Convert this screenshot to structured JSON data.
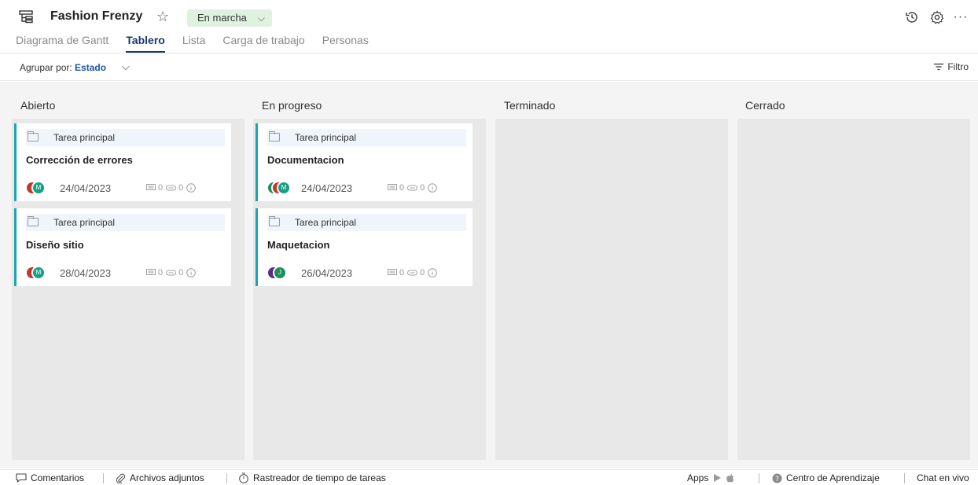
{
  "header": {
    "project_title": "Fashion Frenzy",
    "status": "En marcha",
    "icons": [
      "project-icon",
      "star-icon",
      "history-icon",
      "settings-icon",
      "more-icon"
    ],
    "tabs": [
      {
        "label": "Diagrama de Gantt",
        "active": false
      },
      {
        "label": "Tablero",
        "active": true
      },
      {
        "label": "Lista",
        "active": false
      },
      {
        "label": "Carga de trabajo",
        "active": false
      },
      {
        "label": "Personas",
        "active": false
      }
    ]
  },
  "toolbar": {
    "group_label": "Agrupar por:",
    "group_value": "Estado",
    "filter_label": "Filtro"
  },
  "columns": [
    {
      "title": "Abierto",
      "cards": [
        {
          "parent": "Tarea principal",
          "title": "Corrección de errores",
          "date": "24/04/2023",
          "comments": "0",
          "attachments": "0",
          "avatars": [
            "",
            "M"
          ]
        },
        {
          "parent": "Tarea principal",
          "title": "Diseño sitio",
          "date": "28/04/2023",
          "comments": "0",
          "attachments": "0",
          "avatars": [
            "",
            "M"
          ]
        }
      ]
    },
    {
      "title": "En progreso",
      "cards": [
        {
          "parent": "Tarea principal",
          "title": "Documentacion",
          "date": "24/04/2023",
          "comments": "0",
          "attachments": "0",
          "avatars": [
            "",
            "",
            "M"
          ]
        },
        {
          "parent": "Tarea principal",
          "title": "Maquetacion",
          "date": "26/04/2023",
          "comments": "0",
          "attachments": "0",
          "avatars": [
            "",
            "J"
          ]
        }
      ]
    },
    {
      "title": "Terminado",
      "cards": []
    },
    {
      "title": "Cerrado",
      "cards": []
    }
  ],
  "footer": {
    "comments": "Comentarios",
    "attachments": "Archivos adjuntos",
    "time_tracker": "Rastreador de tiempo de tareas",
    "apps": "Apps",
    "learning_center": "Centro de Aprendizaje",
    "live_chat": "Chat en vivo"
  },
  "colors": {
    "accent_navy": "#1a3a6c",
    "card_accent": "#19a6b3",
    "status_badge_bg": "#dff2e0",
    "avatar_red": "#c0392b",
    "avatar_teal": "#16a085",
    "avatar_purple": "#5b2c83",
    "avatar_green": "#1e8e5a"
  }
}
